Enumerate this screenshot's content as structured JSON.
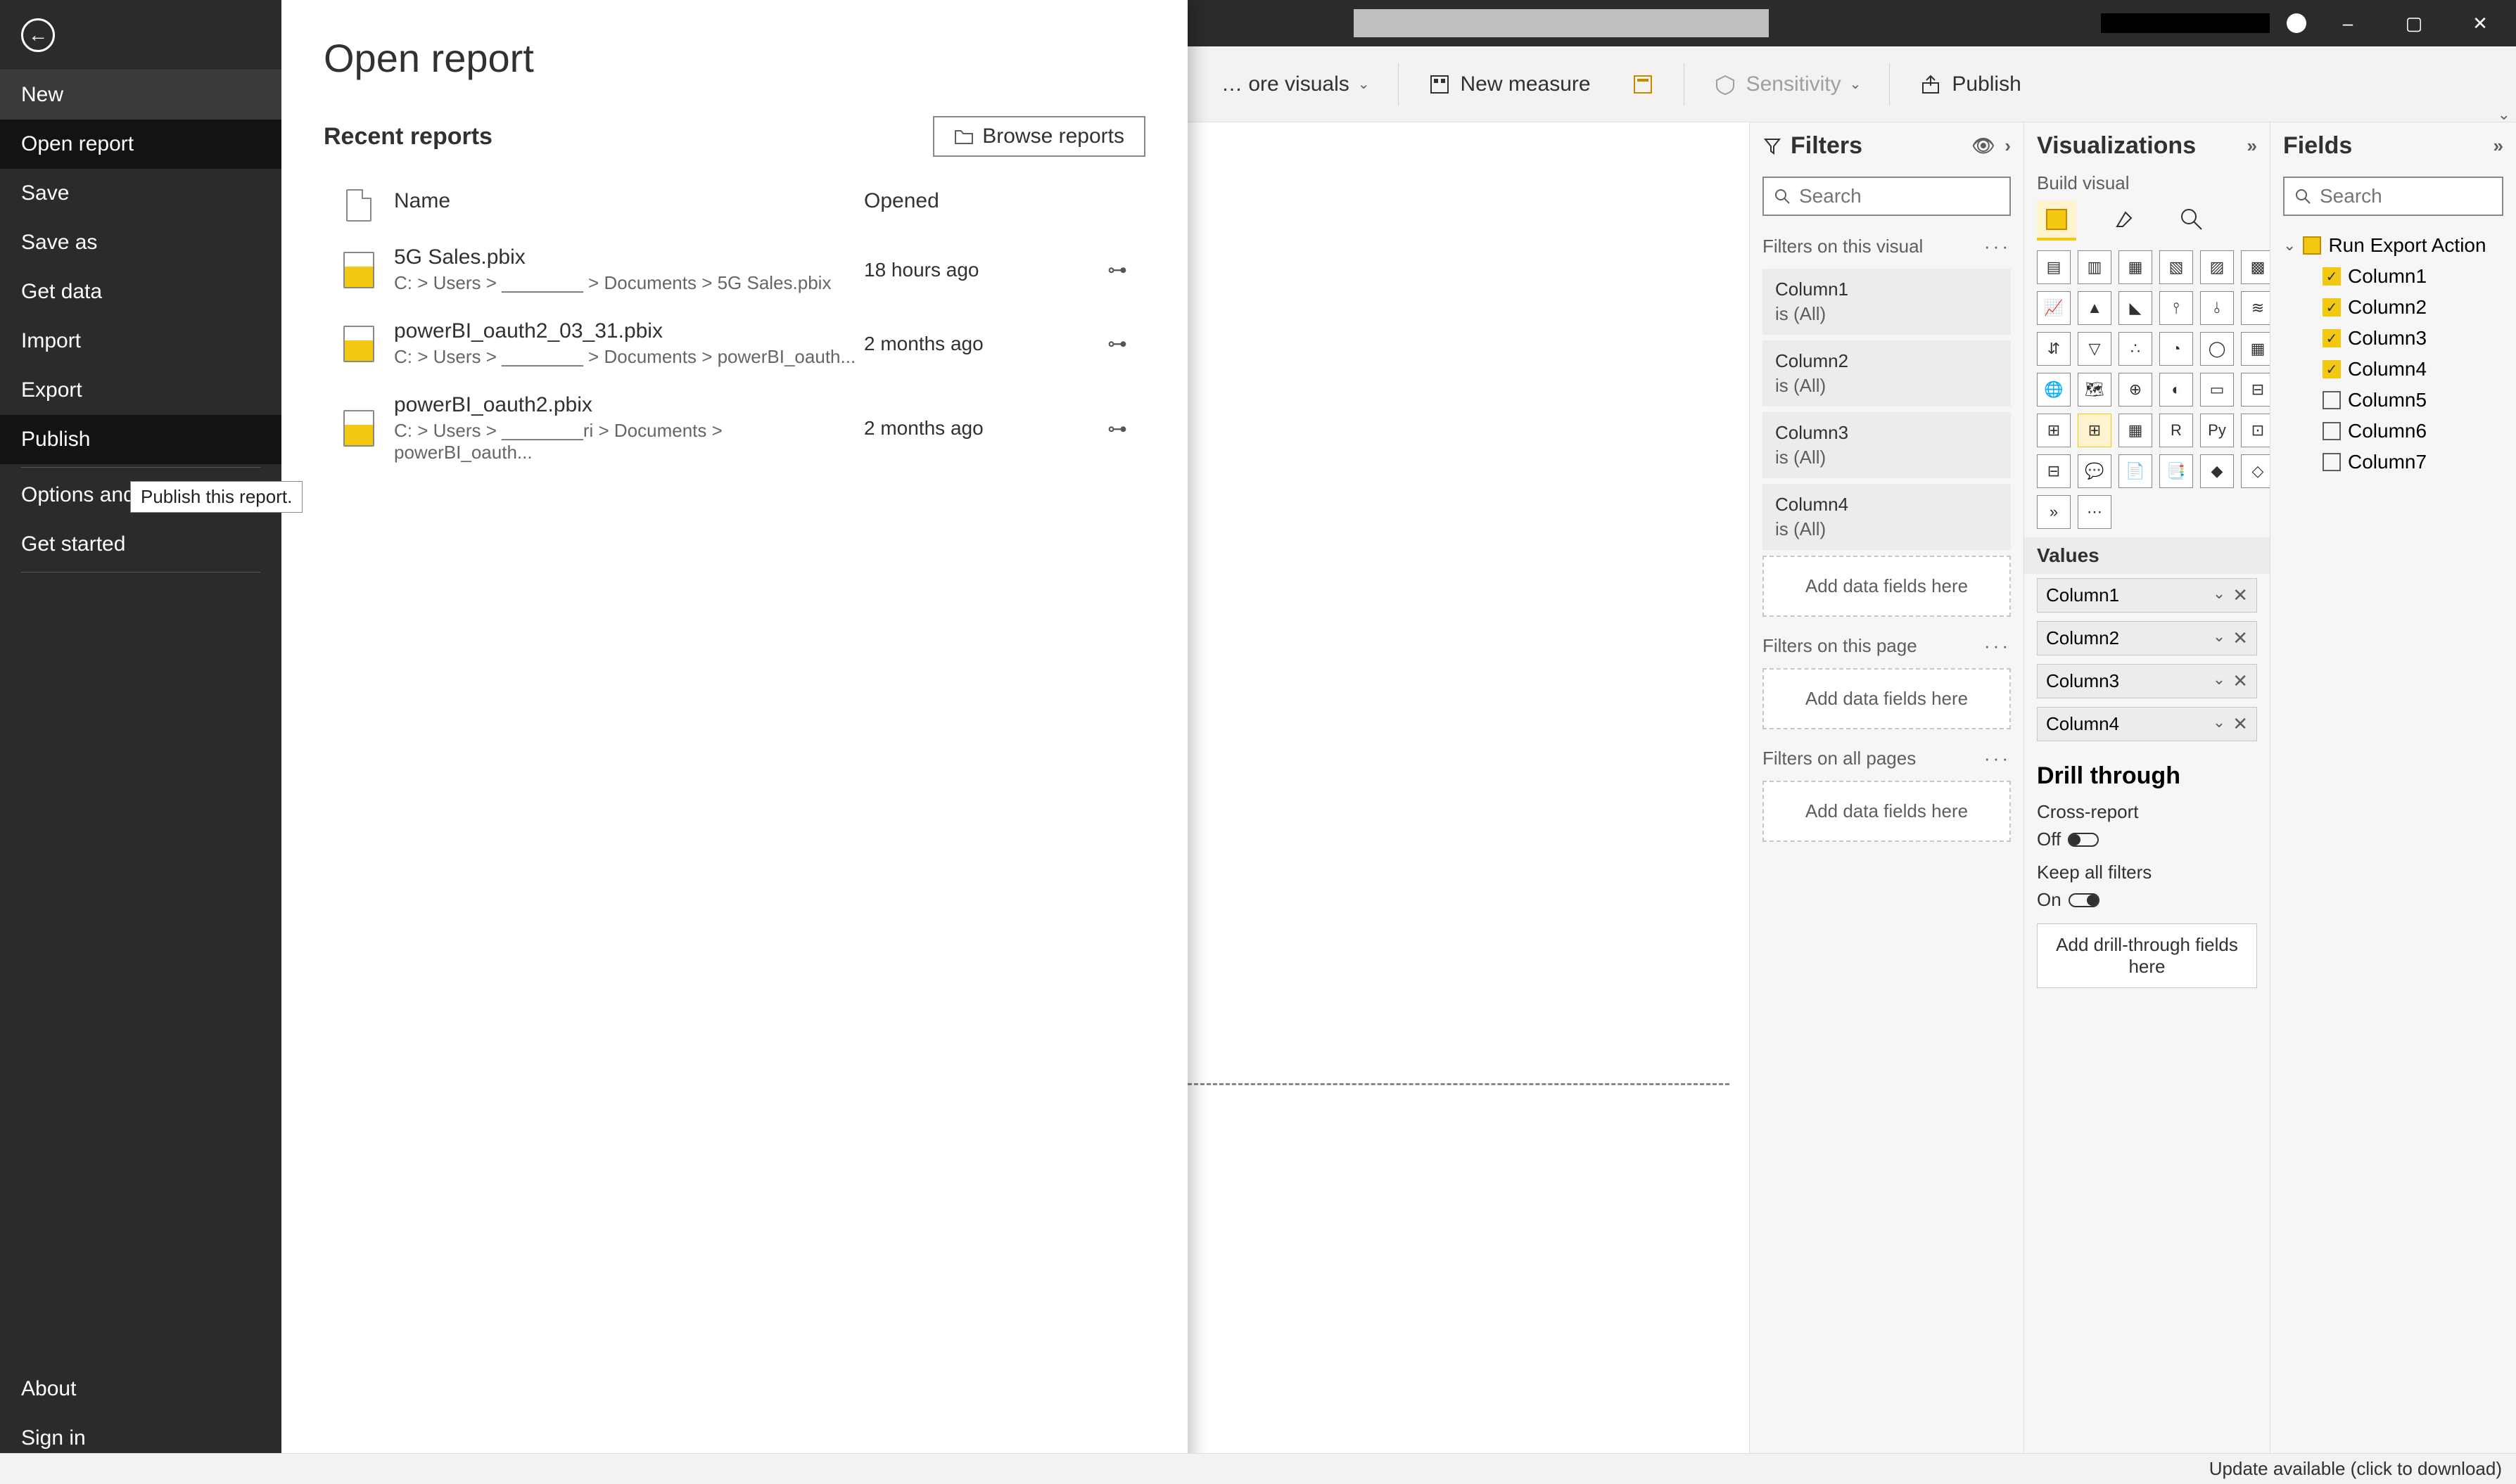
{
  "titlebar": {
    "minimize": "–",
    "maximize": "▢",
    "close": "✕"
  },
  "ribbon": {
    "more_visuals": "… ore visuals",
    "new_measure": "New measure",
    "sensitivity": "Sensitivity",
    "publish": "Publish"
  },
  "backstage": {
    "items": {
      "new": "New",
      "open_report": "Open report",
      "save": "Save",
      "save_as": "Save as",
      "get_data": "Get data",
      "import": "Import",
      "export": "Export",
      "publish": "Publish",
      "options": "Options and settings",
      "get_started": "Get started",
      "about": "About",
      "sign_in": "Sign in"
    },
    "tooltip": "Publish this report."
  },
  "open_report": {
    "title": "Open report",
    "recent_label": "Recent reports",
    "browse_label": "Browse reports",
    "col_name": "Name",
    "col_opened": "Opened",
    "files": [
      {
        "name": "5G Sales.pbix",
        "path": "C: > Users > ________ > Documents > 5G Sales.pbix",
        "opened": "18 hours ago"
      },
      {
        "name": "powerBI_oauth2_03_31.pbix",
        "path": "C: > Users > ________ > Documents > powerBI_oauth...",
        "opened": "2 months ago"
      },
      {
        "name": "powerBI_oauth2.pbix",
        "path": "C: > Users > ________ri > Documents > powerBI_oauth...",
        "opened": "2 months ago"
      }
    ]
  },
  "filters": {
    "title": "Filters",
    "search_ph": "Search",
    "sect_visual": "Filters on this visual",
    "sect_page": "Filters on this page",
    "sect_all": "Filters on all pages",
    "add_fields": "Add data fields here",
    "is_all": "is (All)",
    "cards": [
      "Column1",
      "Column2",
      "Column3",
      "Column4"
    ]
  },
  "viz": {
    "title": "Visualizations",
    "sub": "Build visual",
    "values_label": "Values",
    "value_fields": [
      "Column1",
      "Column2",
      "Column3",
      "Column4"
    ],
    "drill_title": "Drill through",
    "cross_report": "Cross-report",
    "off": "Off",
    "keep_filters": "Keep all filters",
    "on": "On",
    "drill_drop": "Add drill-through fields here"
  },
  "fields": {
    "title": "Fields",
    "search_ph": "Search",
    "table": "Run Export Action",
    "cols": [
      {
        "name": "Column1",
        "checked": true
      },
      {
        "name": "Column2",
        "checked": true
      },
      {
        "name": "Column3",
        "checked": true
      },
      {
        "name": "Column4",
        "checked": true
      },
      {
        "name": "Column5",
        "checked": false
      },
      {
        "name": "Column6",
        "checked": false
      },
      {
        "name": "Column7",
        "checked": false
      }
    ]
  },
  "status": {
    "update": "Update available (click to download)"
  }
}
